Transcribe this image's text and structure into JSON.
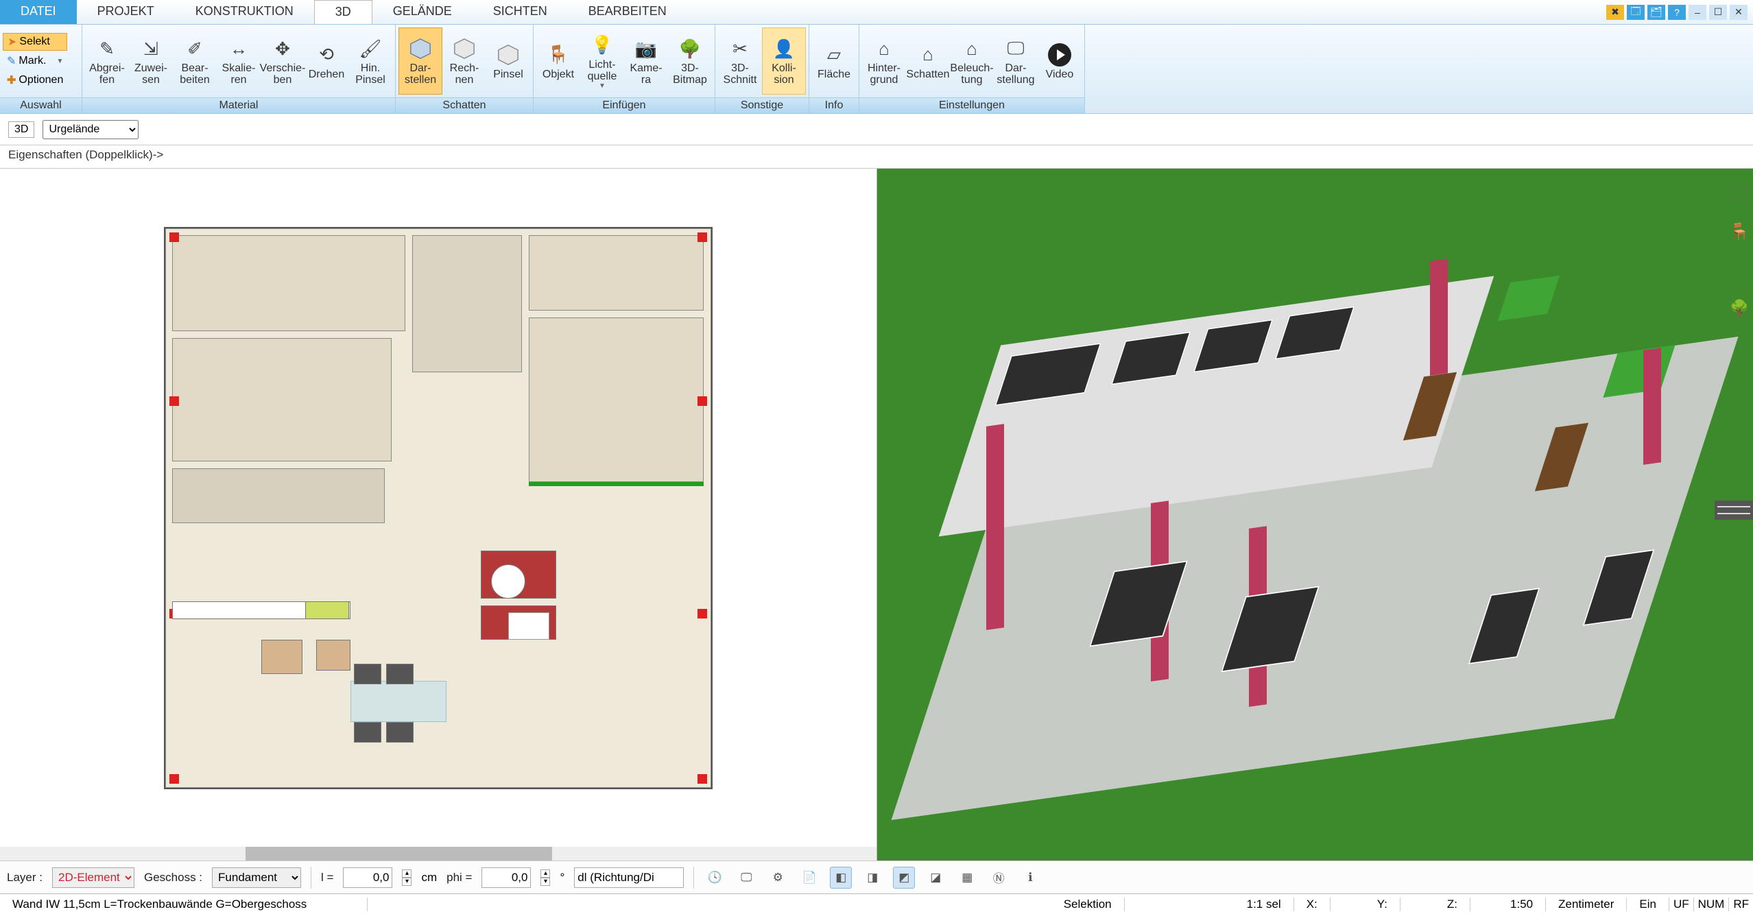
{
  "menu": {
    "tabs": [
      "DATEI",
      "PROJEKT",
      "KONSTRUKTION",
      "3D",
      "GELÄNDE",
      "SICHTEN",
      "BEARBEITEN"
    ],
    "active": "3D"
  },
  "selection": {
    "selekt": "Selekt",
    "mark": "Mark.",
    "optionen": "Optionen",
    "group": "Auswahl"
  },
  "ribbon": {
    "material": {
      "label": "Material",
      "items": [
        "Abgrei-\nfen",
        "Zuwei-\nsen",
        "Bear-\nbeiten",
        "Skalie-\nren",
        "Verschie-\nben",
        "Drehen",
        "Hin.\nPinsel"
      ]
    },
    "schatten": {
      "label": "Schatten",
      "items": [
        "Dar-\nstellen",
        "Rech-\nnen",
        "Pinsel"
      ]
    },
    "einfuegen": {
      "label": "Einfügen",
      "items": [
        "Objekt",
        "Licht-\nquelle",
        "Kame-\nra",
        "3D-\nBitmap"
      ]
    },
    "sonstige": {
      "label": "Sonstige",
      "items": [
        "3D-\nSchnitt",
        "Kolli-\nsion"
      ]
    },
    "info": {
      "label": "Info",
      "items": [
        "Fläche"
      ]
    },
    "einstellungen": {
      "label": "Einstellungen",
      "items": [
        "Hinter-\ngrund",
        "Schatten",
        "Beleuch-\ntung",
        "Dar-\nstellung",
        "Video"
      ]
    }
  },
  "context": {
    "view3d": "3D",
    "dropdown": "Urgelände"
  },
  "properties_hint": "Eigenschaften (Doppelklick)->",
  "bottom": {
    "layer_label": "Layer :",
    "layer_value": "2D-Element",
    "geschoss_label": "Geschoss :",
    "geschoss_value": "Fundament",
    "l_label": "l =",
    "l_value": "0,0",
    "l_unit": "cm",
    "phi_label": "phi =",
    "phi_value": "0,0",
    "phi_unit": "°",
    "dl_value": "dl (Richtung/Di"
  },
  "status": {
    "desc": "Wand IW 11,5cm L=Trockenbauwände G=Obergeschoss",
    "selektion": "Selektion",
    "sel": "1:1 sel",
    "x": "X:",
    "y": "Y:",
    "z": "Z:",
    "scale": "1:50",
    "unit": "Zentimeter",
    "ein": "Ein",
    "uf": "UF",
    "num": "NUM",
    "rf": "RF"
  }
}
